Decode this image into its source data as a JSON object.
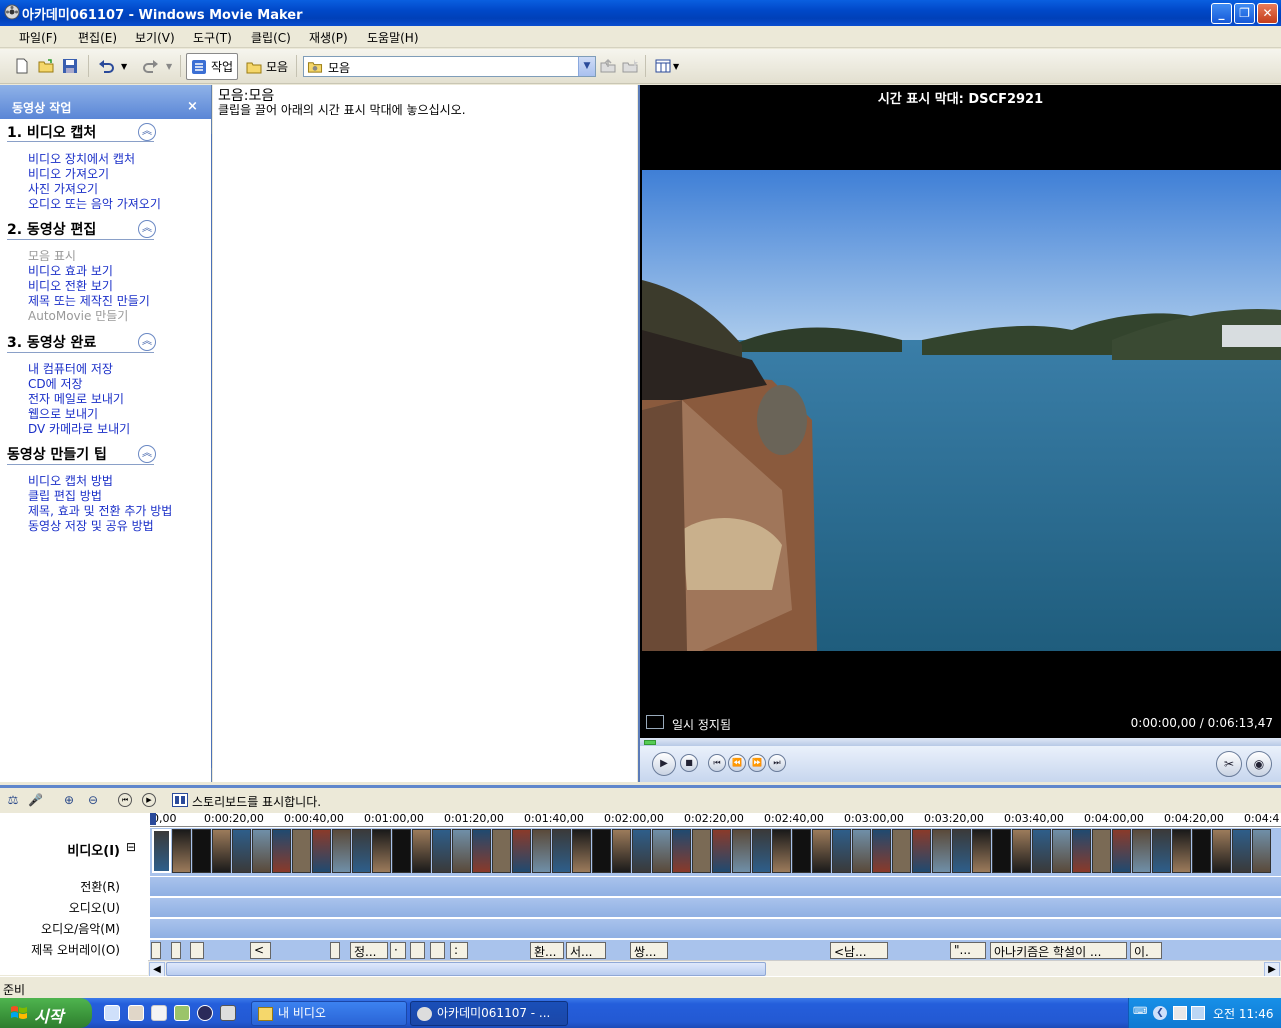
{
  "window": {
    "title": "아카데미061107 - Windows Movie Maker",
    "buttons": [
      "minimize",
      "maximize",
      "close"
    ]
  },
  "menu": [
    "파일(F)",
    "편집(E)",
    "보기(V)",
    "도구(T)",
    "클립(C)",
    "재생(P)",
    "도움말(H)"
  ],
  "toolbar": {
    "tasks_label": "작업",
    "collections_label": "모음",
    "collection_value": "모음"
  },
  "taskpane": {
    "title": "동영상 작업",
    "close": "×",
    "sections": [
      {
        "title": "1. 비디오 캡처",
        "items": [
          {
            "label": "비디오 장치에서 캡처",
            "enabled": true
          },
          {
            "label": "비디오 가져오기",
            "enabled": true
          },
          {
            "label": "사진 가져오기",
            "enabled": true
          },
          {
            "label": "오디오 또는 음악 가져오기",
            "enabled": true
          }
        ]
      },
      {
        "title": "2. 동영상 편집",
        "items": [
          {
            "label": "모음 표시",
            "enabled": false
          },
          {
            "label": "비디오 효과 보기",
            "enabled": true
          },
          {
            "label": "비디오 전환 보기",
            "enabled": true
          },
          {
            "label": "제목 또는 제작진 만들기",
            "enabled": true
          },
          {
            "label": "AutoMovie 만들기",
            "enabled": false
          }
        ]
      },
      {
        "title": "3. 동영상 완료",
        "items": [
          {
            "label": "내 컴퓨터에 저장",
            "enabled": true
          },
          {
            "label": "CD에 저장",
            "enabled": true
          },
          {
            "label": "전자 메일로 보내기",
            "enabled": true
          },
          {
            "label": "웹으로 보내기",
            "enabled": true
          },
          {
            "label": "DV 카메라로 보내기",
            "enabled": true
          }
        ]
      },
      {
        "title": "동영상 만들기 팁",
        "items": [
          {
            "label": "비디오 캡처 방법",
            "enabled": true
          },
          {
            "label": "클립 편집 방법",
            "enabled": true
          },
          {
            "label": "제목, 효과 및 전환 추가 방법",
            "enabled": true
          },
          {
            "label": "동영상 저장 및 공유 방법",
            "enabled": true
          }
        ]
      }
    ]
  },
  "collection": {
    "title": "모음:모음",
    "hint": "클립을 끌어 아래의 시간 표시 막대에 놓으십시오."
  },
  "monitor": {
    "title": "시간 표시 막대: DSCF2921",
    "status": "일시 정지됨",
    "time": "0:00:00,00 / 0:06:13,47"
  },
  "timeline": {
    "hint": "스토리보드를 표시합니다.",
    "ruler": [
      "0,00",
      "0:00:20,00",
      "0:00:40,00",
      "0:01:00,00",
      "0:01:20,00",
      "0:01:40,00",
      "0:02:00,00",
      "0:02:20,00",
      "0:02:40,00",
      "0:03:00,00",
      "0:03:20,00",
      "0:03:40,00",
      "0:04:00,00",
      "0:04:20,00",
      "0:04:4"
    ],
    "tracks": {
      "video": "비디오(I)",
      "video_toggle": "⊟",
      "transition": "전환(R)",
      "audio": "오디오(U)",
      "audio_music": "오디오/음악(M)",
      "title_overlay": "제목 오버레이(O)"
    },
    "overlay_clips": [
      "",
      "",
      "",
      "<",
      "",
      "정...",
      "·",
      "",
      "",
      ":",
      "환...",
      "서...",
      "쌍...",
      "<남...",
      "\"...",
      "아나키즘은 학설이 ...",
      "이."
    ]
  },
  "status_bar": "준비",
  "taskbar": {
    "start": "시작",
    "tasks": [
      "내 비디오",
      "아카데미061107 - ..."
    ],
    "clock": "오전 11:46"
  }
}
